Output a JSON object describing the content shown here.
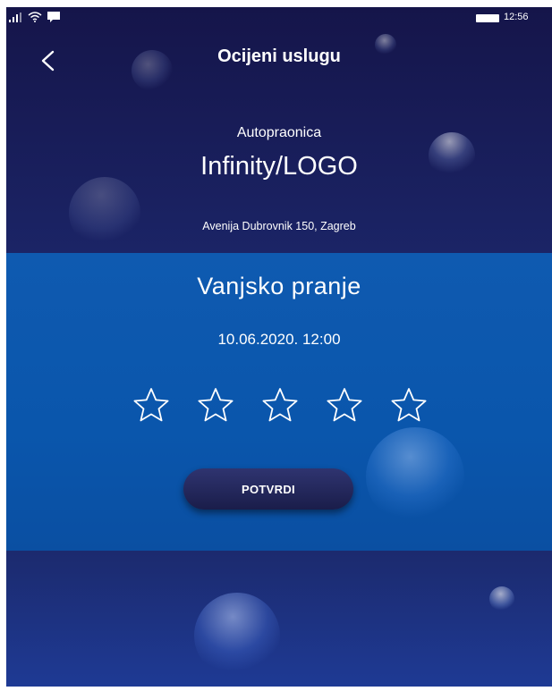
{
  "status_bar": {
    "time": "12:56"
  },
  "header": {
    "title": "Ocijeni uslugu",
    "back_icon": "chevron-left-icon"
  },
  "business": {
    "category": "Autopraonica",
    "name": "Infinity/LOGO",
    "address": "Avenija Dubrovnik 150, Zagreb"
  },
  "service": {
    "name": "Vanjsko pranje",
    "datetime": "10.06.2020.  12:00"
  },
  "rating": {
    "max_stars": 5,
    "selected": 0,
    "star_icon": "star-outline-icon"
  },
  "actions": {
    "confirm_label": "POTVRDI"
  },
  "colors": {
    "header_bg": "#15154a",
    "card_bg": "#0f5ab0",
    "footer_bg": "#1c2a6e",
    "button_bg": "#1a1d4a",
    "text": "#ffffff"
  }
}
